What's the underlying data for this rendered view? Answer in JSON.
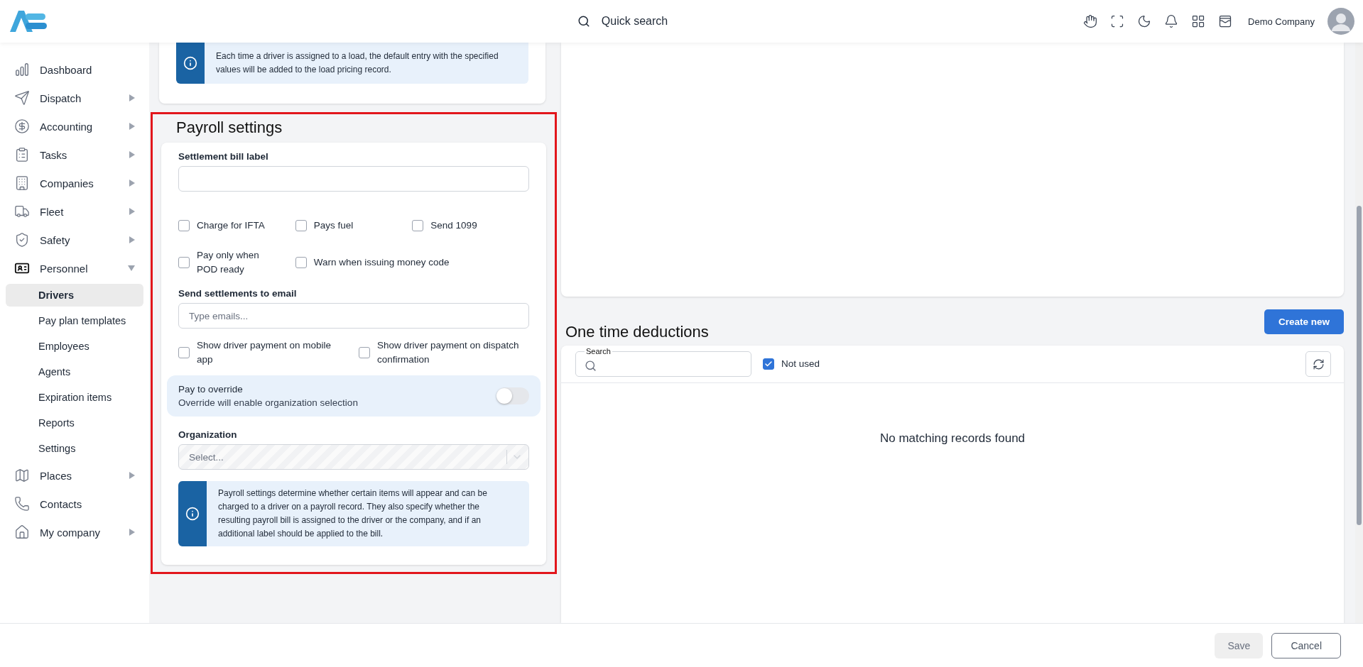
{
  "header": {
    "search_label": "Quick search",
    "company": "Demo Company"
  },
  "sidebar": {
    "items": [
      {
        "label": "Dashboard",
        "expandable": false,
        "expanded": false
      },
      {
        "label": "Dispatch",
        "expandable": true,
        "expanded": false
      },
      {
        "label": "Accounting",
        "expandable": true,
        "expanded": false
      },
      {
        "label": "Tasks",
        "expandable": true,
        "expanded": false
      },
      {
        "label": "Companies",
        "expandable": true,
        "expanded": false
      },
      {
        "label": "Fleet",
        "expandable": true,
        "expanded": false
      },
      {
        "label": "Safety",
        "expandable": true,
        "expanded": false
      },
      {
        "label": "Personnel",
        "expandable": true,
        "expanded": true,
        "children": [
          {
            "label": "Drivers",
            "selected": true
          },
          {
            "label": "Pay plan templates",
            "selected": false
          },
          {
            "label": "Employees",
            "selected": false
          },
          {
            "label": "Agents",
            "selected": false
          },
          {
            "label": "Expiration items",
            "selected": false
          },
          {
            "label": "Reports",
            "selected": false
          },
          {
            "label": "Settings",
            "selected": false
          }
        ]
      },
      {
        "label": "Places",
        "expandable": true,
        "expanded": false
      },
      {
        "label": "Contacts",
        "expandable": false,
        "expanded": false
      },
      {
        "label": "My company",
        "expandable": true,
        "expanded": false
      }
    ]
  },
  "top_card": {
    "info": "Each time a driver is assigned to a load, the default entry with the specified values will be added to the load pricing record."
  },
  "payroll": {
    "title": "Payroll settings",
    "bill_label": {
      "label": "Settlement bill label"
    },
    "checkbox_rows": [
      [
        {
          "label": "Charge for IFTA",
          "checked": false
        },
        {
          "label": "Pays fuel",
          "checked": false
        },
        {
          "label": "Send 1099",
          "checked": false
        }
      ],
      [
        {
          "label": "Pay only when POD ready",
          "checked": false
        },
        {
          "label": "Warn when issuing money code",
          "checked": false
        }
      ]
    ],
    "email": {
      "label": "Send settlements to email",
      "placeholder": "Type emails..."
    },
    "display_checkboxes": [
      {
        "label": "Show driver payment on mobile app",
        "checked": false
      },
      {
        "label": "Show driver payment on dispatch confirmation",
        "checked": false
      }
    ],
    "override": {
      "title": "Pay to override",
      "subtitle": "Override will enable organization selection",
      "on": false
    },
    "organization": {
      "label": "Organization",
      "placeholder": "Select...",
      "disabled": true
    },
    "info": "Payroll settings determine whether certain items will appear and can be charged to a driver on a payroll record. They also specify whether the resulting payroll bill is assigned to the driver or the company, and if an additional label should be applied to the bill."
  },
  "deductions": {
    "title": "One time deductions",
    "create_button": "Create new",
    "search": {
      "label": "Search"
    },
    "not_used": {
      "label": "Not used",
      "checked": true
    },
    "empty": "No matching records found"
  },
  "footer": {
    "buttons": [
      {
        "label": "Save",
        "kind": "primary",
        "disabled": true
      },
      {
        "label": "Cancel",
        "kind": "secondary",
        "disabled": false
      }
    ]
  }
}
